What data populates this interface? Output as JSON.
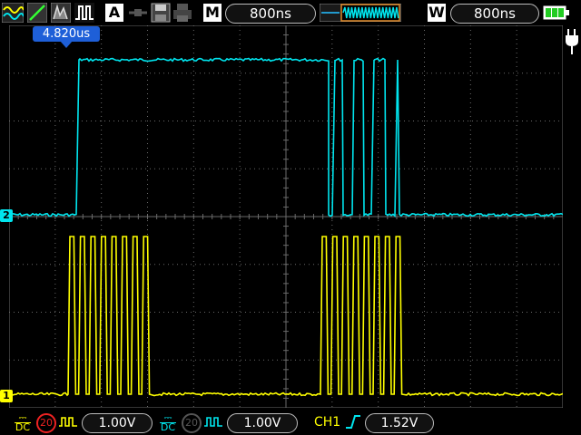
{
  "toolbar": {
    "icons": [
      "autoset-icon",
      "trigger-slope-icon",
      "persist-icon",
      "pulse-icon",
      "acquire-icon",
      "record-icon",
      "save-icon",
      "print-icon"
    ],
    "acquire_label": "A",
    "main_label": "M",
    "main_timebase": "800ns",
    "window_label": "W",
    "window_timebase": "800ns"
  },
  "screen": {
    "cursor_readout": "4.820us",
    "ch2_marker": "2",
    "ch1_marker": "1"
  },
  "bottom": {
    "ch1_coupling": "DC",
    "ch1_bw": "20",
    "ch1_scale": "1.00V",
    "ch2_coupling": "DC",
    "ch2_bw": "20",
    "ch2_scale": "1.00V",
    "trigger_source": "CH1",
    "trigger_level": "1.52V"
  },
  "colors": {
    "ch1": "#ffff00",
    "ch2": "#00e5ee",
    "grid": "#6a6a6a",
    "cursor_box": "#1e5fd8"
  }
}
